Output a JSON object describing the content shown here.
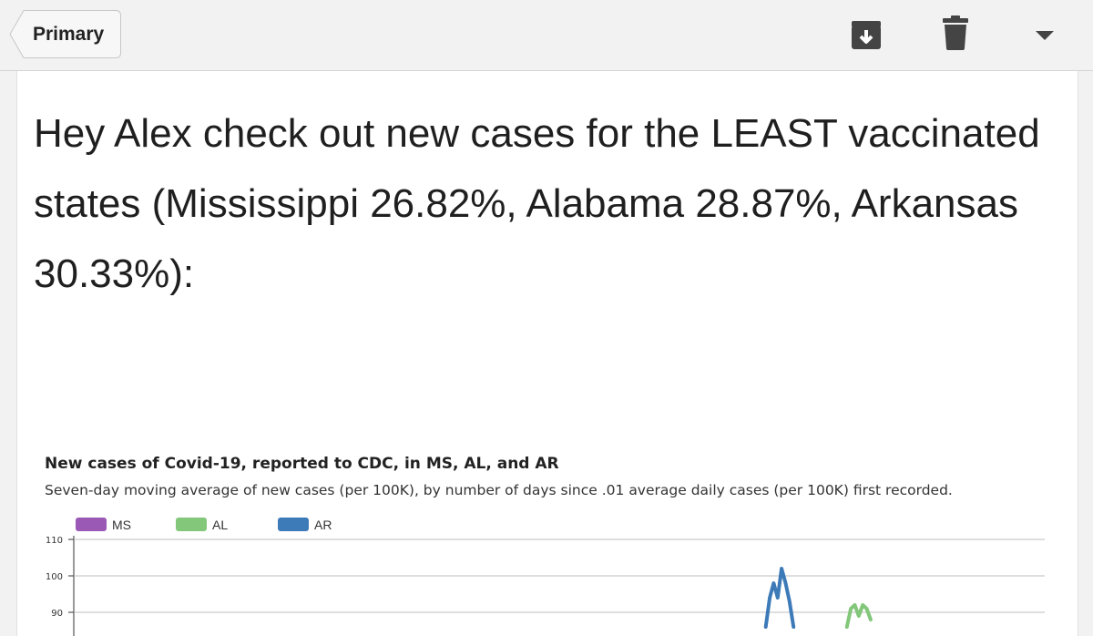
{
  "header": {
    "back_label": "Primary",
    "icons": [
      "archive-icon",
      "trash-icon",
      "chevron-down-icon"
    ]
  },
  "message": {
    "text": "Hey Alex check out new cases for the LEAST vaccinated states (Mississippi 26.82%, Alabama 28.87%, Arkansas 30.33%):"
  },
  "chart_data": {
    "type": "line",
    "title": "New cases of Covid-19, reported to CDC, in MS, AL, and AR",
    "subtitle": "Seven-day moving average of new cases (per 100K), by number of days since .01 average daily cases (per 100K) first recorded.",
    "xlabel": "",
    "ylabel": "",
    "ylim": [
      90,
      110
    ],
    "yticks": [
      "110",
      "100",
      "90"
    ],
    "grid": true,
    "legend": "top-left",
    "series": [
      {
        "name": "MS",
        "color": "#9b59b6",
        "points": []
      },
      {
        "name": "AL",
        "color": "#82c77a",
        "points": [
          [
            0.8,
            86
          ],
          [
            0.804,
            91
          ],
          [
            0.808,
            92
          ],
          [
            0.812,
            89
          ],
          [
            0.816,
            92
          ],
          [
            0.82,
            91
          ],
          [
            0.824,
            88
          ]
        ]
      },
      {
        "name": "AR",
        "color": "#3d7ab8",
        "points": [
          [
            0.718,
            86
          ],
          [
            0.722,
            94
          ],
          [
            0.726,
            98
          ],
          [
            0.73,
            94
          ],
          [
            0.734,
            102
          ],
          [
            0.738,
            98
          ],
          [
            0.742,
            93
          ],
          [
            0.746,
            86
          ]
        ]
      }
    ]
  }
}
